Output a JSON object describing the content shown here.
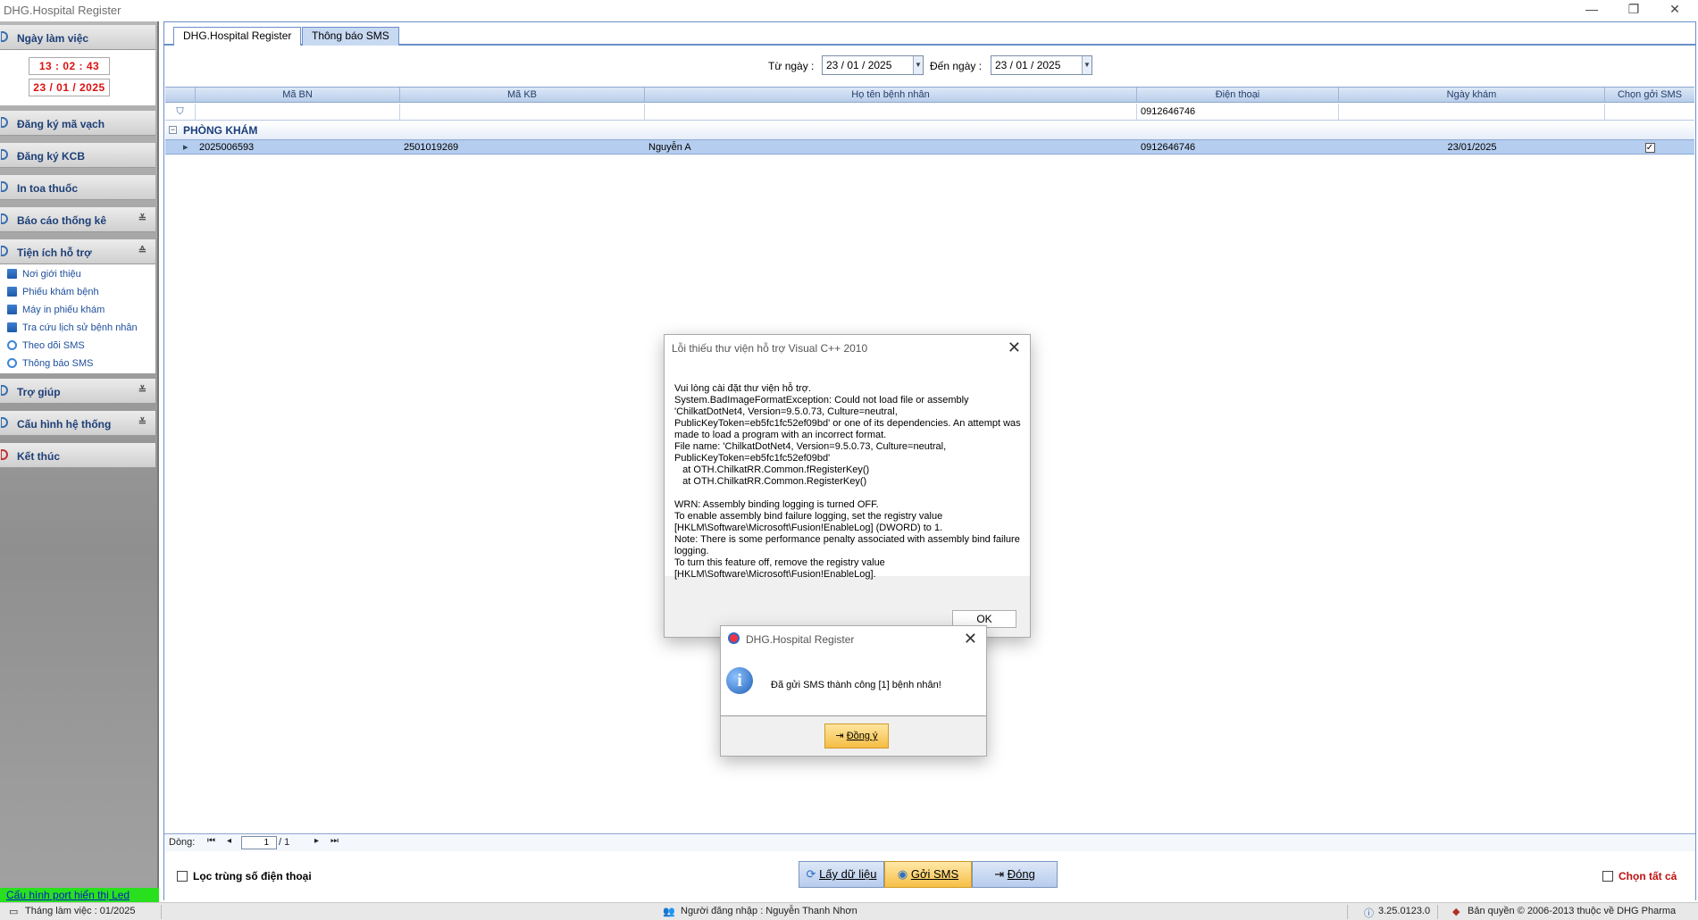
{
  "window": {
    "title": "DHG.Hospital Register",
    "minimize": "—",
    "restore": "❐",
    "close": "✕"
  },
  "sidebar": {
    "workday": {
      "label": "Ngày làm việc",
      "time": "13 : 02 : 43",
      "date": "23 / 01 / 2025"
    },
    "groups": [
      {
        "label": "Đăng ký mã vạch"
      },
      {
        "label": "Đăng ký KCB"
      },
      {
        "label": "In toa thuốc"
      },
      {
        "label": "Báo cáo thống kê",
        "chevron": "≚"
      },
      {
        "label": "Tiện ích hỗ trợ",
        "chevron": "≙"
      },
      {
        "label": "Trợ giúp",
        "chevron": "≚"
      },
      {
        "label": "Cấu hình hệ thống",
        "chevron": "≚"
      },
      {
        "label": "Kết thúc"
      }
    ],
    "subitems": [
      {
        "label": "Nơi giới thiệu"
      },
      {
        "label": "Phiếu khám bệnh"
      },
      {
        "label": "Máy in phiếu khám"
      },
      {
        "label": "Tra cứu lịch sử bệnh nhân"
      },
      {
        "label": "Theo dõi SMS"
      },
      {
        "label": "Thông báo SMS"
      }
    ],
    "led_link": "Cấu hình port hiển thị Led"
  },
  "tabs": [
    {
      "label": "DHG.Hospital Register"
    },
    {
      "label": "Thông báo SMS"
    }
  ],
  "filter": {
    "from_label": "Từ ngày :",
    "from_value": "23 / 01 / 2025",
    "to_label": "Đến ngày :",
    "to_value": "23 / 01 / 2025"
  },
  "grid": {
    "columns": [
      "Mã BN",
      "Mã KB",
      "Họ tên bệnh nhân",
      "Điện thoại",
      "Ngày khám",
      "Chọn gởi SMS"
    ],
    "filter_phone": "0912646746",
    "group_label": "PHÒNG KHÁM",
    "group_toggle": "−",
    "rows": [
      {
        "ma_bn": "2025006593",
        "ma_kb": "2501019269",
        "ho_ten": "Nguyễn A",
        "dien_thoai": "0912646746",
        "ngay_kham": "23/01/2025",
        "chon": "✓"
      }
    ]
  },
  "pager": {
    "label": "Dòng:",
    "current": "1",
    "total": "/ 1"
  },
  "bottom": {
    "filter_dup_phone": "Lọc trùng số điện thoại",
    "btn_fetch": "Lấy dữ liệu",
    "btn_send": "Gởi SMS",
    "btn_close": "Đóng",
    "select_all": "Chọn tất cả"
  },
  "status": {
    "month": "Tháng làm việc : 01/2025",
    "user": "Người đăng nhập : Nguyễn Thanh Nhơn",
    "version": "3.25.0123.0",
    "copyright": "Bản quyền © 2006-2013 thuộc về DHG Pharma"
  },
  "error_dialog": {
    "title": "Lỗi thiếu thư viện hỗ trợ Visual C++ 2010",
    "message": "Vui lòng cài đặt thư viện hỗ trợ.\nSystem.BadImageFormatException: Could not load file or assembly 'ChilkatDotNet4, Version=9.5.0.73, Culture=neutral, PublicKeyToken=eb5fc1fc52ef09bd' or one of its dependencies. An attempt was made to load a program with an incorrect format.\nFile name: 'ChilkatDotNet4, Version=9.5.0.73, Culture=neutral, PublicKeyToken=eb5fc1fc52ef09bd'\n   at OTH.ChilkatRR.Common.fRegisterKey()\n   at OTH.ChilkatRR.Common.RegisterKey()\n\nWRN: Assembly binding logging is turned OFF.\nTo enable assembly bind failure logging, set the registry value [HKLM\\Software\\Microsoft\\Fusion!EnableLog] (DWORD) to 1.\nNote: There is some performance penalty associated with assembly bind failure logging.\nTo turn this feature off, remove the registry value [HKLM\\Software\\Microsoft\\Fusion!EnableLog].",
    "ok": "OK"
  },
  "info_dialog": {
    "title": "DHG.Hospital Register",
    "message": "Đã gửi SMS thành công [1] bệnh nhân!",
    "ok": "Đồng ý"
  }
}
